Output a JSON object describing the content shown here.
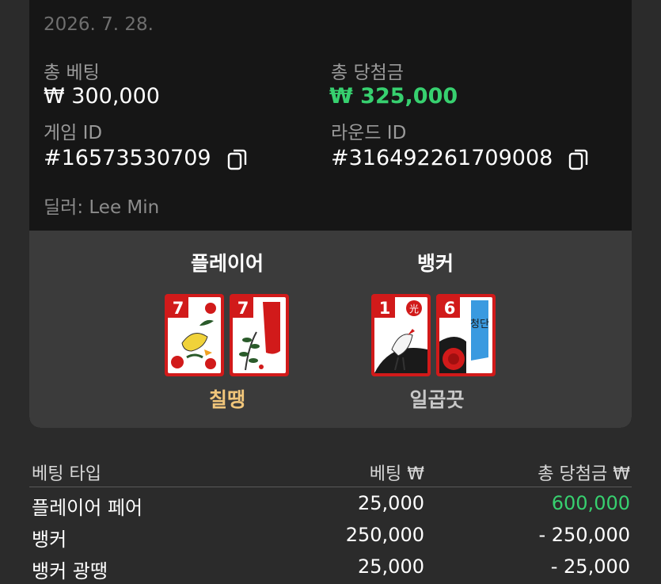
{
  "header": {
    "date": "2026. 7. 28."
  },
  "summary": {
    "total_bet_label": "총 베팅",
    "total_bet_value": "₩ 300,000",
    "total_win_label": "총 당첨금",
    "total_win_value": "₩ 325,000",
    "game_id_label": "게임 ID",
    "game_id_value": "#16573530709",
    "round_id_label": "라운드 ID",
    "round_id_value": "#316492261709008",
    "dealer": "딜러: Lee Min"
  },
  "player": {
    "title": "플레이어",
    "result": "칠땡",
    "cards": [
      {
        "number": "7"
      },
      {
        "number": "7"
      }
    ]
  },
  "banker": {
    "title": "뱅커",
    "result": "일곱끗",
    "cards": [
      {
        "number": "1",
        "badge": "光"
      },
      {
        "number": "6",
        "ribbon": "청단"
      }
    ]
  },
  "colors": {
    "win_green": "#37d06f",
    "player_result": "#f0c57a",
    "banker_result": "#c8c8c8",
    "card_red": "#d11a1a"
  },
  "table": {
    "headers": [
      "베팅 타입",
      "베팅 ₩",
      "총 당첨금 ₩"
    ],
    "rows": [
      {
        "type": "플레이어 페어",
        "bet": "25,000",
        "win": "600,000",
        "win_positive": true
      },
      {
        "type": "뱅커",
        "bet": "250,000",
        "win": "- 250,000",
        "win_positive": false
      },
      {
        "type": "뱅커 광땡",
        "bet": "25,000",
        "win": "- 25,000",
        "win_positive": false
      }
    ]
  },
  "icons": {
    "copy": "copy-icon"
  }
}
